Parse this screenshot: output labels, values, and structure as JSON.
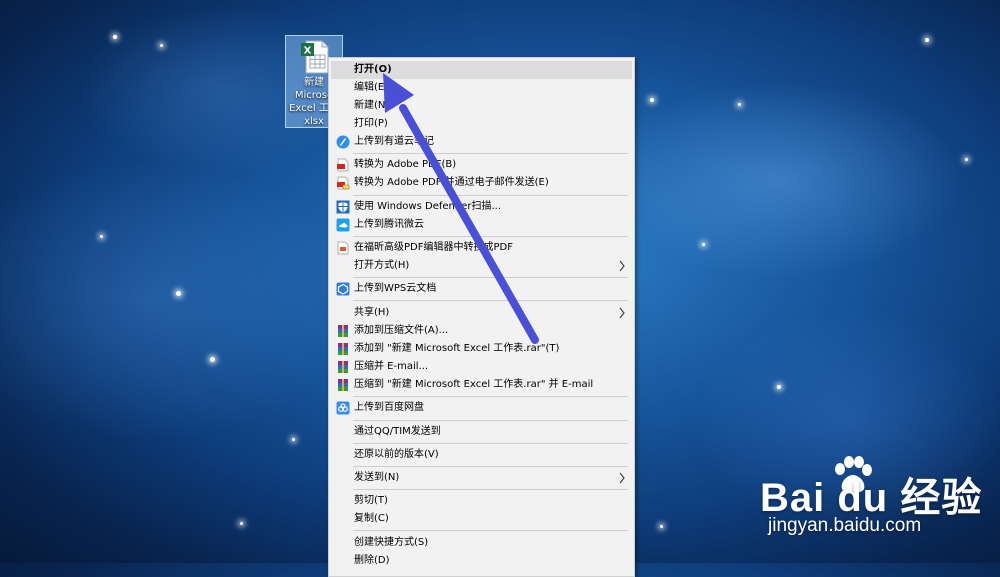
{
  "desktop_icon": {
    "label_lines": [
      "新建",
      "Microso",
      "Excel 工作",
      "xlsx"
    ]
  },
  "context_menu": {
    "items": [
      {
        "label": "打开(O)",
        "icon": "none",
        "bold": true,
        "highlighted": true
      },
      {
        "label": "编辑(E)",
        "icon": "none"
      },
      {
        "label": "新建(N)",
        "icon": "none"
      },
      {
        "label": "打印(P)",
        "icon": "none"
      },
      {
        "label": "上传到有道云笔记",
        "icon": "youdao-note-icon"
      },
      {
        "label": "转换为 Adobe PDF(B)",
        "icon": "adobe-pdf-icon"
      },
      {
        "label": "转换为 Adobe PDF 并通过电子邮件发送(E)",
        "icon": "adobe-pdf-mail-icon"
      },
      {
        "label": "使用 Windows Defender扫描...",
        "icon": "windows-defender-icon"
      },
      {
        "label": "上传到腾讯微云",
        "icon": "weiyun-icon"
      },
      {
        "label": "在福昕高级PDF编辑器中转换成PDF",
        "icon": "foxit-pdf-icon"
      },
      {
        "label": "打开方式(H)",
        "icon": "none",
        "submenu": true
      },
      {
        "label": "上传到WPS云文档",
        "icon": "wps-cloud-icon"
      },
      {
        "label": "共享(H)",
        "icon": "none",
        "submenu": true
      },
      {
        "label": "添加到压缩文件(A)...",
        "icon": "winrar-icon"
      },
      {
        "label": "添加到 \"新建 Microsoft Excel 工作表.rar\"(T)",
        "icon": "winrar-icon"
      },
      {
        "label": "压缩并 E-mail...",
        "icon": "winrar-icon"
      },
      {
        "label": "压缩到 \"新建 Microsoft Excel 工作表.rar\" 并 E-mail",
        "icon": "winrar-icon"
      },
      {
        "label": "上传到百度网盘",
        "icon": "baidu-netdisk-icon"
      },
      {
        "label": "通过QQ/TIM发送到",
        "icon": "none"
      },
      {
        "label": "还原以前的版本(V)",
        "icon": "none"
      },
      {
        "label": "发送到(N)",
        "icon": "none",
        "submenu": true
      },
      {
        "label": "剪切(T)",
        "icon": "none"
      },
      {
        "label": "复制(C)",
        "icon": "none"
      },
      {
        "label": "创建快捷方式(S)",
        "icon": "none"
      },
      {
        "label": "删除(D)",
        "icon": "none"
      }
    ]
  },
  "watermark": {
    "logo_text": "Bai du 经验",
    "url": "jingyan.baidu.com"
  },
  "colors": {
    "menu_bg": "#f2f2f2",
    "menu_highlight": "#dcdcdc",
    "arrow": "#4a4fd8",
    "excel_green": "#1e7145"
  }
}
